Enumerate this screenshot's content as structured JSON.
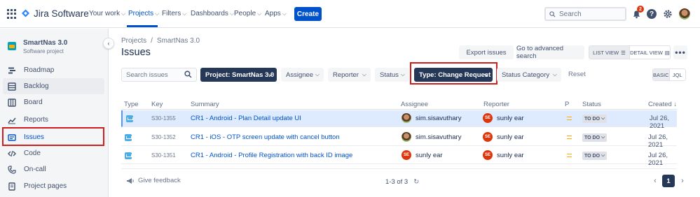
{
  "app": {
    "name": "Jira Software"
  },
  "nav": {
    "items": [
      {
        "label": "Your work"
      },
      {
        "label": "Projects"
      },
      {
        "label": "Filters"
      },
      {
        "label": "Dashboards"
      },
      {
        "label": "People"
      },
      {
        "label": "Apps"
      }
    ],
    "create_label": "Create",
    "search_placeholder": "Search",
    "notification_count": "2",
    "help_label": "?"
  },
  "sidebar": {
    "project_name": "SmartNas 3.0",
    "project_type": "Software project",
    "items": [
      {
        "label": "Roadmap"
      },
      {
        "label": "Backlog"
      },
      {
        "label": "Board"
      },
      {
        "label": "Reports"
      },
      {
        "label": "Issues"
      },
      {
        "label": "Code"
      },
      {
        "label": "On-call"
      },
      {
        "label": "Project pages"
      }
    ]
  },
  "breadcrumb": {
    "root": "Projects",
    "sep": "/",
    "project": "SmartNas 3.0"
  },
  "page": {
    "title": "Issues"
  },
  "toolbar": {
    "export": "Export issues",
    "advanced": "Go to advanced search",
    "list_view": "LIST VIEW",
    "detail_view": "DETAIL VIEW",
    "more": "•••"
  },
  "filters": {
    "search_placeholder": "Search issues",
    "project": "Project: SmartNas 3.0",
    "assignee": "Assignee",
    "reporter": "Reporter",
    "status": "Status",
    "type": "Type: Change Request",
    "status_category": "Status Category",
    "reset": "Reset",
    "basic": "BASIC",
    "jql": "JQL"
  },
  "table": {
    "headers": {
      "type": "Type",
      "key": "Key",
      "summary": "Summary",
      "assignee": "Assignee",
      "reporter": "Reporter",
      "priority": "P",
      "status": "Status",
      "created": "Created ↓"
    },
    "rows": [
      {
        "key": "S30-1355",
        "summary": "CR1 - Android - Plan Detail update UI",
        "assignee": "sim.sisavuthary",
        "reporter": "sunly ear",
        "reporter_initials": "SE",
        "status": "TO DO",
        "created": "Jul 26, 2021"
      },
      {
        "key": "S30-1352",
        "summary": "CR1 - iOS - OTP screen update with cancel button",
        "assignee": "sim.sisavuthary",
        "reporter": "sunly ear",
        "reporter_initials": "SE",
        "status": "TO DO",
        "created": "Jul 26, 2021"
      },
      {
        "key": "S30-1351",
        "summary": "CR1 - Android - Profile Registration with back ID image",
        "assignee": "sunly ear",
        "assignee_initials": "SE",
        "reporter": "sunly ear",
        "reporter_initials": "SE",
        "status": "TO DO",
        "created": "Jul 26, 2021"
      }
    ]
  },
  "footer": {
    "feedback": "Give feedback",
    "range": "1-3 of 3",
    "current_page": "1"
  }
}
